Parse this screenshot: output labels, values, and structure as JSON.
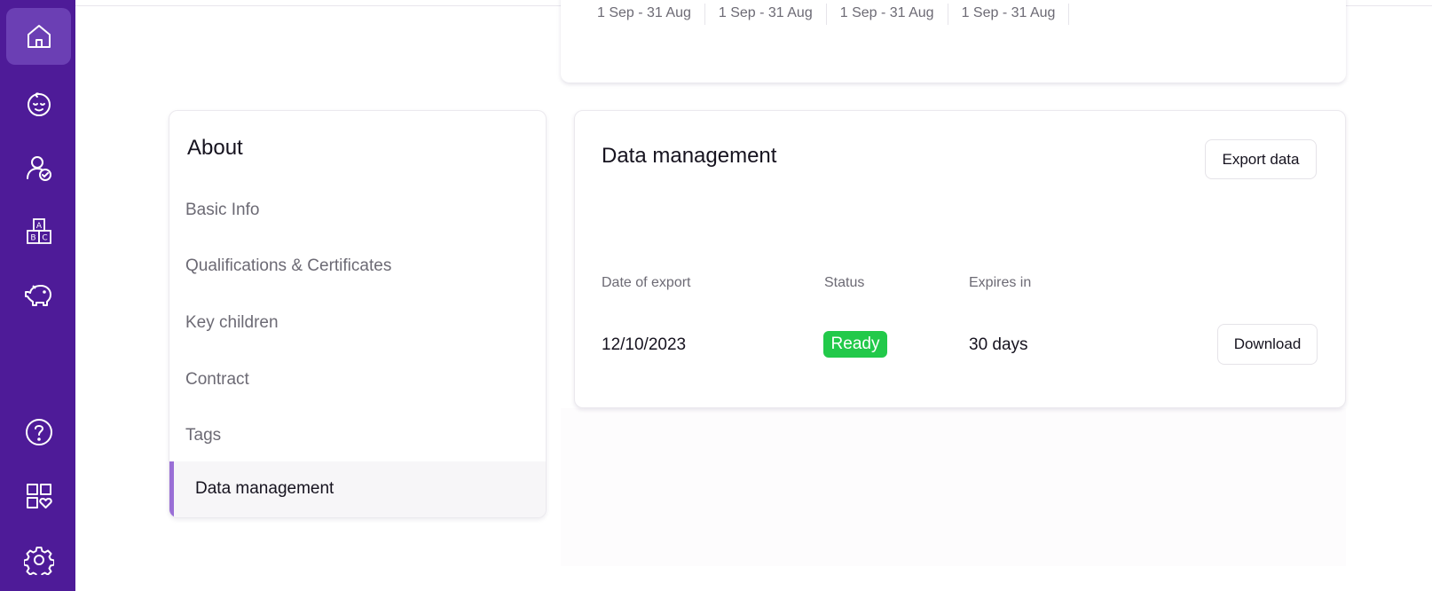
{
  "sidebar": {
    "items": [
      {
        "icon": "home-icon",
        "active": true
      },
      {
        "icon": "baby-face-icon",
        "active": false
      },
      {
        "icon": "user-check-icon",
        "active": false
      },
      {
        "icon": "abc-blocks-icon",
        "active": false
      },
      {
        "icon": "piggy-bank-icon",
        "active": false
      },
      {
        "icon": "help-icon",
        "active": false
      },
      {
        "icon": "apps-heart-icon",
        "active": false
      },
      {
        "icon": "settings-gear-icon",
        "active": false
      }
    ],
    "colors": {
      "background": "#4e1b98",
      "active": "#6b3fb4"
    }
  },
  "periods": [
    "1 Sep - 31 Aug",
    "1 Sep - 31 Aug",
    "1 Sep - 31 Aug",
    "1 Sep - 31 Aug"
  ],
  "about": {
    "title": "About",
    "items": [
      "Basic Info",
      "Qualifications & Certificates",
      "Key children",
      "Contract",
      "Tags"
    ],
    "active_item": "Data management",
    "accent_color": "#9a6fd6"
  },
  "data_management": {
    "title": "Data management",
    "export_button": "Export data",
    "columns": [
      "Date of export",
      "Status",
      "Expires in"
    ],
    "rows": [
      {
        "date": "12/10/2023",
        "status": "Ready",
        "expires": "30 days",
        "action": "Download"
      }
    ],
    "status_color": "#22c94a"
  }
}
